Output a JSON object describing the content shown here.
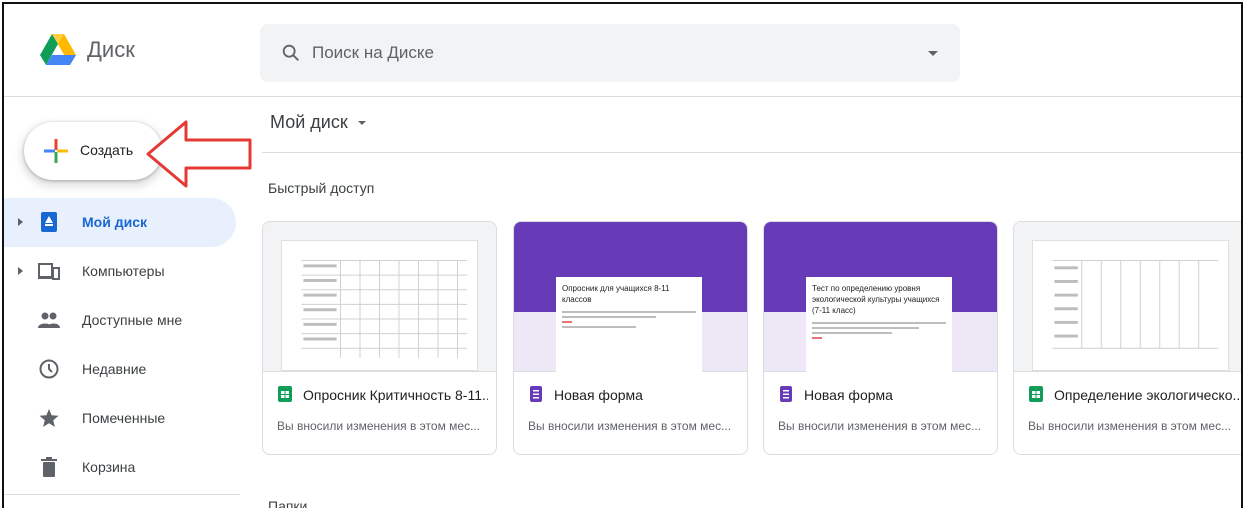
{
  "app": {
    "title": "Диск"
  },
  "search": {
    "placeholder": "Поиск на Диске"
  },
  "create": {
    "label": "Создать"
  },
  "sidebar": {
    "items": [
      {
        "label": "Мой диск",
        "icon": "drive-icon",
        "active": true,
        "expandable": true
      },
      {
        "label": "Компьютеры",
        "icon": "computer-icon",
        "active": false,
        "expandable": true
      },
      {
        "label": "Доступные мне",
        "icon": "shared-people-icon",
        "active": false,
        "expandable": false
      },
      {
        "label": "Недавние",
        "icon": "clock-icon",
        "active": false,
        "expandable": false
      },
      {
        "label": "Помеченные",
        "icon": "star-icon",
        "active": false,
        "expandable": false
      },
      {
        "label": "Корзина",
        "icon": "trash-icon",
        "active": false,
        "expandable": false
      }
    ]
  },
  "main": {
    "breadcrumb": "Мой диск",
    "quick_access_title": "Быстрый доступ",
    "folders_title": "Папки",
    "cards": [
      {
        "type": "sheet",
        "icon": "sheets-icon",
        "name": "Опросник Критичность 8-11...",
        "subtitle": "Вы вносили изменения в этом мес..."
      },
      {
        "type": "form",
        "icon": "forms-icon",
        "name": "Новая форма",
        "subtitle": "Вы вносили изменения в этом мес...",
        "preview_title": "Опросник для учащихся 8-11 классов"
      },
      {
        "type": "form",
        "icon": "forms-icon",
        "name": "Новая форма",
        "subtitle": "Вы вносили изменения в этом мес...",
        "preview_title": "Тест по определению уровня экологической культуры учащихся (7-11 класс)"
      },
      {
        "type": "sheet",
        "icon": "sheets-icon",
        "name": "Определение экологическо...",
        "subtitle": "Вы вносили изменения в этом мес..."
      }
    ]
  },
  "colors": {
    "accent_blue": "#1967d2",
    "active_bg": "#e8f0fe",
    "forms_purple": "#673ab7",
    "sheets_green": "#0f9d58",
    "annotation_red": "#e53935"
  }
}
